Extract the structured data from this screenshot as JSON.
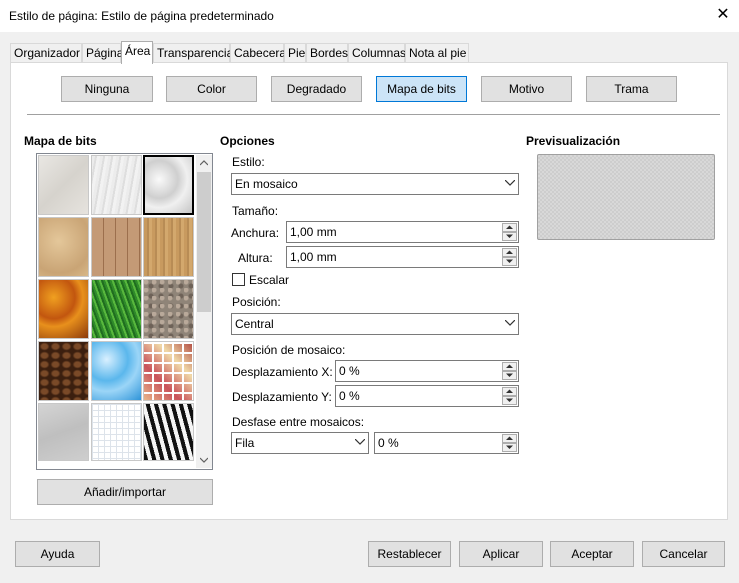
{
  "window": {
    "title": "Estilo de página: Estilo de página predeterminado"
  },
  "tabs": [
    {
      "label": "Organizador"
    },
    {
      "label": "Página"
    },
    {
      "label": "Área"
    },
    {
      "label": "Transparencia"
    },
    {
      "label": "Cabecera"
    },
    {
      "label": "Pie"
    },
    {
      "label": "Bordes"
    },
    {
      "label": "Columnas"
    },
    {
      "label": "Nota al pie"
    }
  ],
  "fill_buttons": [
    {
      "label": "Ninguna"
    },
    {
      "label": "Color"
    },
    {
      "label": "Degradado"
    },
    {
      "label": "Mapa de bits"
    },
    {
      "label": "Motivo"
    },
    {
      "label": "Trama"
    }
  ],
  "bitmap_section": {
    "heading": "Mapa de bits",
    "add_button": "Añadir/importar"
  },
  "bitmaps": [
    {
      "name": "painted-white"
    },
    {
      "name": "paper-texture"
    },
    {
      "name": "paper-crumpled"
    },
    {
      "name": "paper-graph"
    },
    {
      "name": "parchment-paper"
    },
    {
      "name": "fence"
    },
    {
      "name": "wooden-board"
    },
    {
      "name": "maple-leaves"
    },
    {
      "name": "lawn"
    },
    {
      "name": "colorful-pebbles"
    },
    {
      "name": "coffee-beans"
    },
    {
      "name": "little-clouds"
    },
    {
      "name": "bathroom-tiles"
    },
    {
      "name": "wall-of-rock"
    },
    {
      "name": "zebra"
    }
  ],
  "options": {
    "heading": "Opciones",
    "style_label": "Estilo:",
    "style_value": "En mosaico",
    "size_label": "Tamaño:",
    "width_label": "Anchura:",
    "width_value": "1,00 mm",
    "height_label": "Altura:",
    "height_value": "1,00 mm",
    "scale_label": "Escalar",
    "position_label": "Posición:",
    "position_value": "Central",
    "tile_position_label": "Posición de mosaico:",
    "offset_x_label": "Desplazamiento X:",
    "offset_x_value": "0 %",
    "offset_y_label": "Desplazamiento Y:",
    "offset_y_value": "0 %",
    "tile_offset_label": "Desfase entre mosaicos:",
    "tile_offset_mode": "Fila",
    "tile_offset_value": "0 %"
  },
  "preview": {
    "heading": "Previsualización"
  },
  "footer": {
    "help": "Ayuda",
    "reset": "Restablecer",
    "apply": "Aplicar",
    "ok": "Aceptar",
    "cancel": "Cancelar"
  },
  "colors": {
    "selected_button_bg": "#cce4f7",
    "selected_button_border": "#0078d7"
  }
}
